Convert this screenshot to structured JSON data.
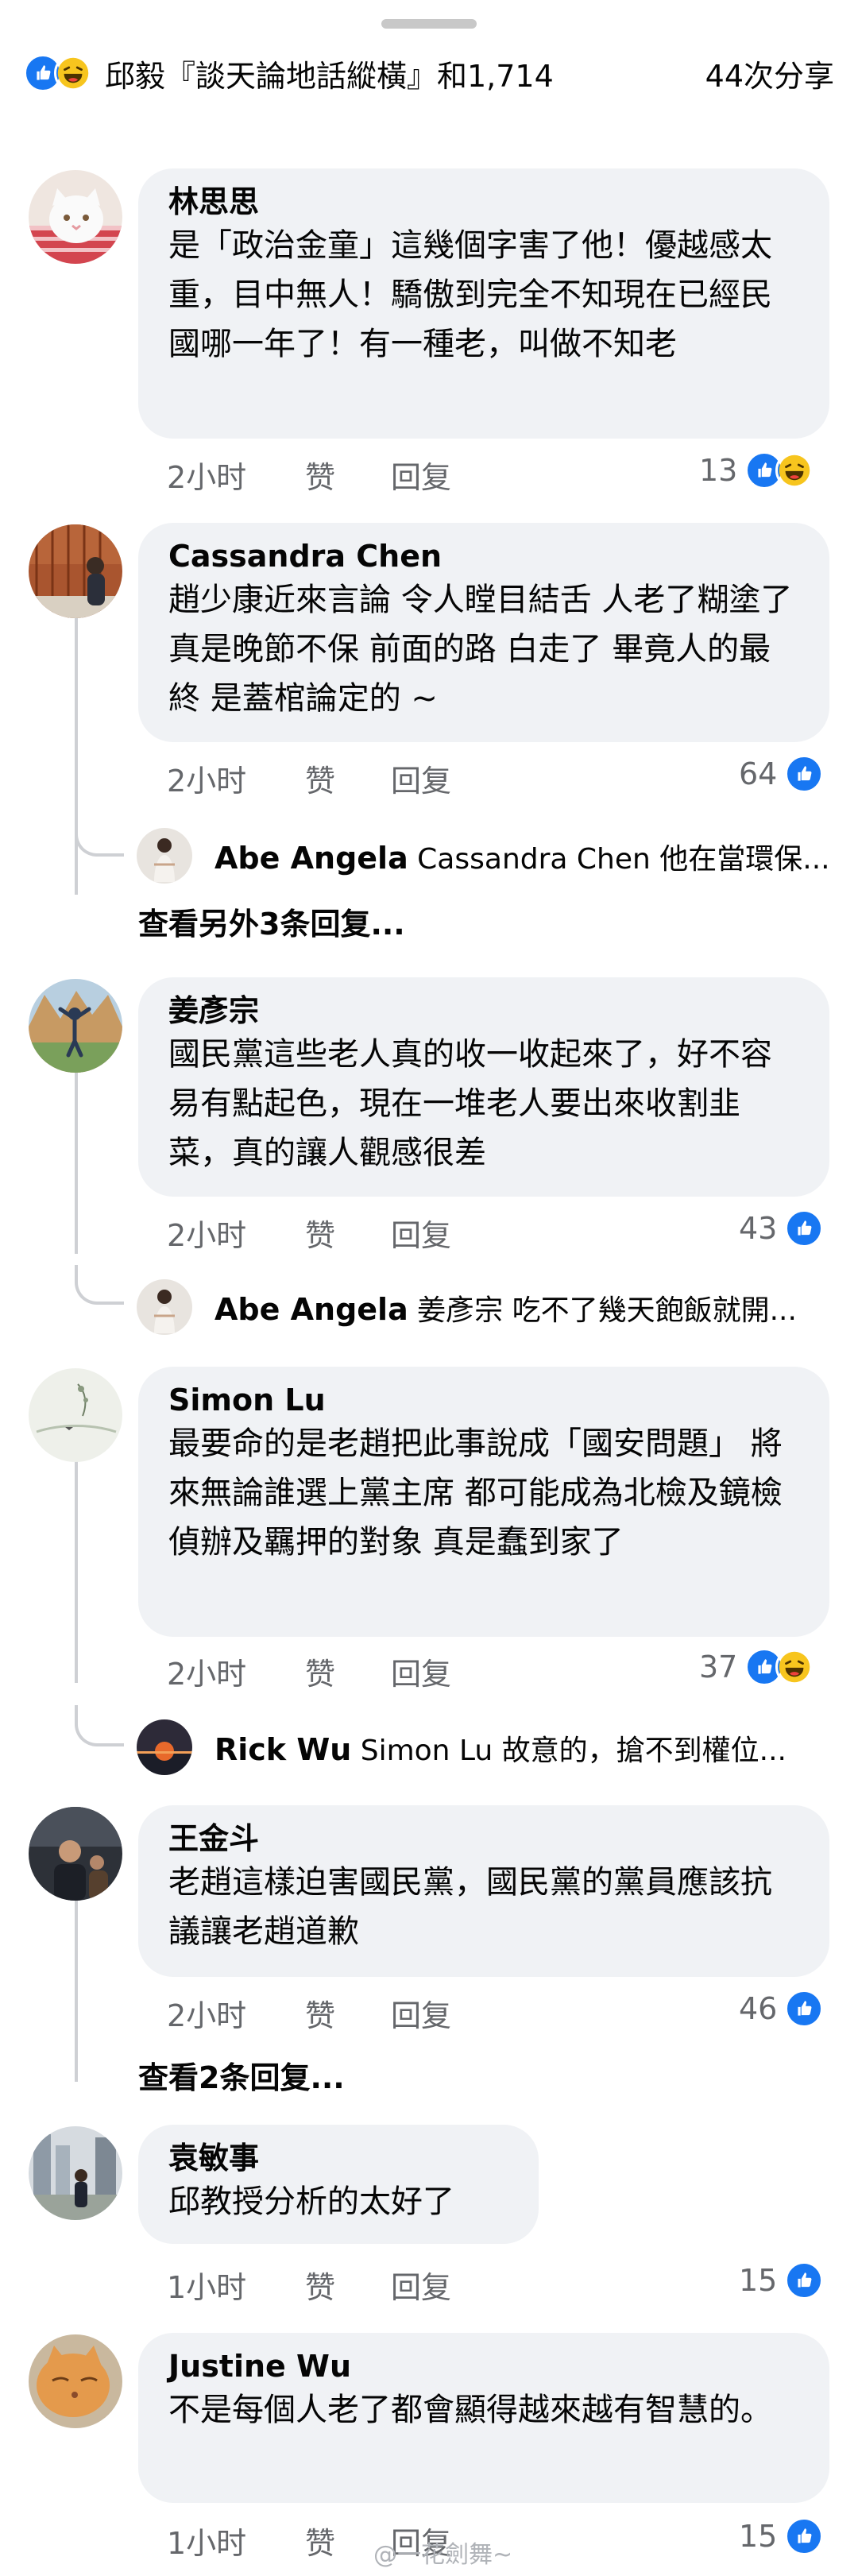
{
  "summary": {
    "text": "邱毅『談天論地話縱橫』和1,714",
    "shares": "44次分享",
    "reactions": [
      "like-icon",
      "haha-icon"
    ]
  },
  "actions": {
    "like": "赞",
    "reply": "回复"
  },
  "comments": [
    {
      "author": "林思思",
      "text": "是「政治金童」這幾個字害了他！優越感太重，目中無人！驕傲到完全不知現在已經民國哪一年了！有一種老，叫做不知老",
      "time": "2小时",
      "count": "13"
    },
    {
      "author": "Cassandra Chen",
      "text": "趙少康近來言論 令人瞠目結舌 人老了糊塗了 真是晚節不保 前面的路 白走了 畢竟人的最終 是蓋棺論定的 ~",
      "time": "2小时",
      "count": "64",
      "reply": {
        "author": "Abe Angela",
        "text": "Cassandra Chen 他在當環保..."
      },
      "more": "查看另外3条回复..."
    },
    {
      "author": "姜彥宗",
      "text": "國民黨這些老人真的收一收起來了，好不容易有點起色，現在一堆老人要出來收割韭菜，真的讓人觀感很差",
      "time": "2小时",
      "count": "43",
      "reply": {
        "author": "Abe Angela",
        "text": "姜彥宗 吃不了幾天飽飯就開..."
      }
    },
    {
      "author": "Simon Lu",
      "text": "最要命的是老趙把此事說成「國安問題」 將來無論誰選上黨主席 都可能成為北檢及鏡檢偵辦及羈押的對象 真是蠢到家了",
      "time": "2小时",
      "count": "37",
      "reply": {
        "author": "Rick Wu",
        "text": "Simon Lu 故意的，搶不到權位..."
      }
    },
    {
      "author": "王金斗",
      "text": "老趙這樣迫害國民黨，國民黨的黨員應該抗議讓老趙道歉",
      "time": "2小时",
      "count": "46",
      "more": "查看2条回复..."
    },
    {
      "author": "袁敏事",
      "text": "邱教授分析的太好了",
      "time": "1小时",
      "count": "15"
    },
    {
      "author": "Justine Wu",
      "text": "不是每個人老了都會顯得越來越有智慧的。",
      "time": "1小时",
      "count": "15"
    }
  ],
  "watermark": "@一花劍舞~",
  "colors": {
    "like": "#1877f2",
    "haha": "#f7c51e",
    "bubble": "#f0f2f5",
    "meta": "#65676b"
  }
}
